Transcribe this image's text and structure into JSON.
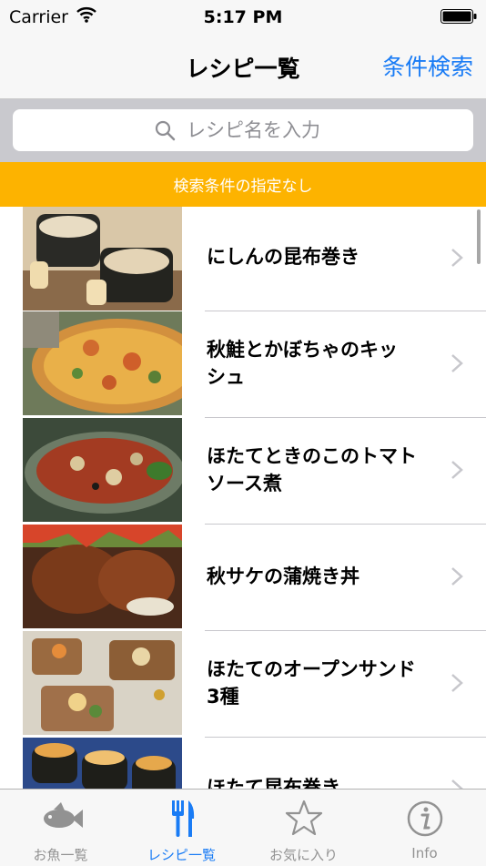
{
  "status_bar": {
    "carrier": "Carrier",
    "time": "5:17 PM"
  },
  "nav": {
    "title": "レシピ一覧",
    "action": "条件検索"
  },
  "search": {
    "placeholder": "レシピ名を入力"
  },
  "banner": {
    "text": "検索条件の指定なし"
  },
  "recipes": [
    {
      "title": "にしんの昆布巻き"
    },
    {
      "title": "秋鮭とかぼちゃのキッシュ",
      "lines": [
        "秋鮭とかぼちゃのキッ",
        "シュ"
      ]
    },
    {
      "title": "ほたてときのこのトマトソース煮",
      "lines": [
        "ほたてときのこのトマト",
        "ソース煮"
      ]
    },
    {
      "title": "秋サケの蒲焼き丼"
    },
    {
      "title": "ほたてのオープンサンド3種",
      "lines": [
        "ほたてのオープンサンド",
        "3種"
      ]
    },
    {
      "title": "ほたて昆布巻き"
    }
  ],
  "tabs": [
    {
      "label": "お魚一覧",
      "icon": "fish-icon",
      "active": false
    },
    {
      "label": "レシピ一覧",
      "icon": "fork-knife-icon",
      "active": true
    },
    {
      "label": "お気に入り",
      "icon": "star-icon",
      "active": false
    },
    {
      "label": "Info",
      "icon": "info-icon",
      "active": false
    }
  ],
  "colors": {
    "accent": "#1a7cf5",
    "banner": "#fdb300",
    "tab_inactive": "#929292"
  }
}
